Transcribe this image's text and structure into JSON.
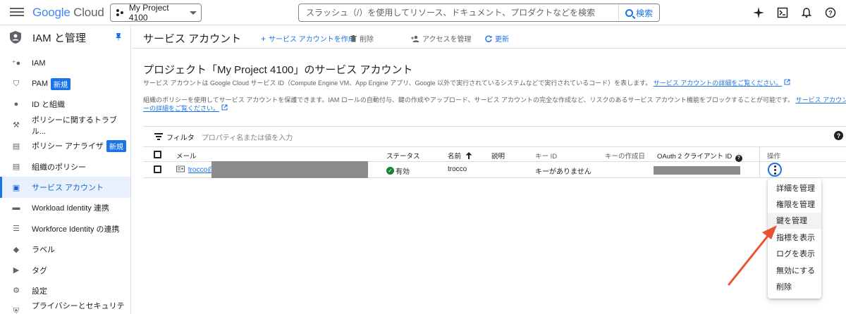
{
  "topbar": {
    "logo_google": "Google",
    "logo_cloud": "Cloud",
    "project": "My Project 4100",
    "search_placeholder": "スラッシュ（/）を使用してリソース、ドキュメント、プロダクトなどを検索",
    "search_button": "検索",
    "icons": [
      "sparkle-icon",
      "terminal-icon",
      "bell-icon",
      "help-icon"
    ]
  },
  "sidebar": {
    "title": "IAM と管理",
    "items": [
      {
        "label": "IAM",
        "icon": "person-add-icon"
      },
      {
        "label": "PAM",
        "icon": "shield-icon",
        "badge": "新規"
      },
      {
        "label": "ID と組織",
        "icon": "account-circle-icon"
      },
      {
        "label": "ポリシーに関するトラブル...",
        "icon": "wrench-icon"
      },
      {
        "label": "ポリシー アナライザ",
        "icon": "analyzer-icon",
        "badge": "新規"
      },
      {
        "label": "組織のポリシー",
        "icon": "document-icon"
      },
      {
        "label": "サービス アカウント",
        "icon": "service-account-icon",
        "active": true
      },
      {
        "label": "Workload Identity 連携",
        "icon": "id-card-icon"
      },
      {
        "label": "Workforce Identity の連携",
        "icon": "list-icon"
      },
      {
        "label": "ラベル",
        "icon": "label-icon"
      },
      {
        "label": "タグ",
        "icon": "tag-icon"
      },
      {
        "label": "設定",
        "icon": "gear-icon"
      },
      {
        "label": "プライバシーとセキュリティ",
        "icon": "privacy-icon"
      }
    ]
  },
  "header": {
    "title": "サービス アカウント",
    "create": "サービス アカウントを作成",
    "delete": "削除",
    "manage_access": "アクセスを管理",
    "refresh": "更新"
  },
  "content": {
    "title": "プロジェクト「My Project 4100」のサービス アカウント",
    "desc1": "サービス アカウントは Google Cloud サービス ID（Compute Engine VM、App Engine アプリ、Google 以外で実行されているシステムなどで実行されているコード）を表します。",
    "desc1_link": "サービス アカウントの詳細をご覧ください。",
    "desc2": "組織のポリシーを使用してサービス アカウントを保護できます。IAM ロールの自動付与、鍵の作成やアップロード、サービス アカウントの完全な作成など、リスクのあるサービス アカウント機能をブロックすることが可能です。",
    "desc2_link_a": "サービス アカウントの組",
    "desc2_link_b": "ーの詳細をご覧ください。"
  },
  "filter": {
    "label": "フィルタ",
    "placeholder": "プロパティ名または値を入力"
  },
  "table": {
    "headers": {
      "email": "メール",
      "status": "ステータス",
      "name": "名前",
      "description": "説明",
      "key_id": "キー ID",
      "key_created": "キーの作成日",
      "oauth": "OAuth 2 クライアント ID",
      "actions": "操作"
    },
    "rows": [
      {
        "email": "trocco@",
        "status": "有効",
        "name": "trocco",
        "description": "",
        "key_id": "キーがありません"
      }
    ]
  },
  "menu": {
    "items": [
      "詳細を管理",
      "権限を管理",
      "鍵を管理",
      "指標を表示",
      "ログを表示",
      "無効にする",
      "削除"
    ]
  },
  "colors": {
    "accent": "#1a73e8",
    "annotation_arrow": "#e8542f"
  }
}
